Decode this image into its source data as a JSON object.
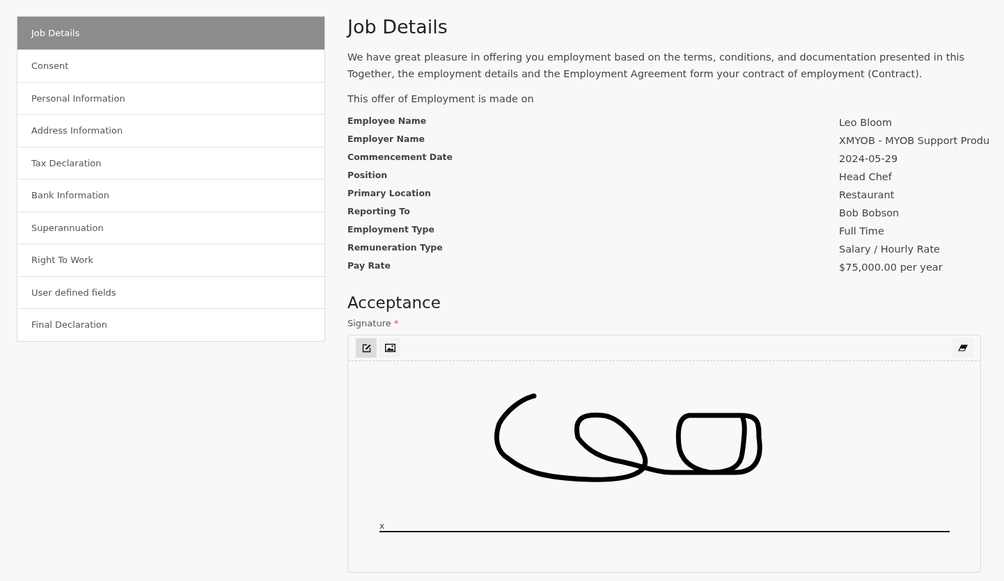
{
  "sidebar": {
    "items": [
      {
        "label": "Job Details",
        "selected": true
      },
      {
        "label": "Consent",
        "selected": false
      },
      {
        "label": "Personal Information",
        "selected": false
      },
      {
        "label": "Address Information",
        "selected": false
      },
      {
        "label": "Tax Declaration",
        "selected": false
      },
      {
        "label": "Bank Information",
        "selected": false
      },
      {
        "label": "Superannuation",
        "selected": false
      },
      {
        "label": "Right To Work",
        "selected": false
      },
      {
        "label": "User defined fields",
        "selected": false
      },
      {
        "label": "Final Declaration",
        "selected": false
      }
    ]
  },
  "main": {
    "title": "Job Details",
    "intro_lines": [
      "We have great pleasure in offering you employment based on the terms, conditions, and documentation presented in this",
      "Together, the employment details and the Employment Agreement form your contract of employment (Contract)."
    ],
    "offer_text": "This offer of Employment is made on",
    "details": [
      {
        "label": "Employee Name",
        "value": "Leo Bloom"
      },
      {
        "label": "Employer Name",
        "value": "XMYOB - MYOB Support Produ"
      },
      {
        "label": "Commencement Date",
        "value": "2024-05-29"
      },
      {
        "label": "Position",
        "value": "Head Chef"
      },
      {
        "label": "Primary Location",
        "value": "Restaurant"
      },
      {
        "label": "Reporting To",
        "value": "Bob Bobson"
      },
      {
        "label": "Employment Type",
        "value": "Full Time"
      },
      {
        "label": "Remuneration Type",
        "value": "Salary / Hourly Rate"
      },
      {
        "label": "Pay Rate",
        "value": "$75,000.00 per year"
      }
    ],
    "acceptance": {
      "title": "Acceptance",
      "signature_label": "Signature",
      "required_mark": "*",
      "tools": [
        {
          "kind": "pen",
          "selected": true
        },
        {
          "kind": "image",
          "selected": false
        }
      ],
      "sign_mark": "x"
    }
  }
}
